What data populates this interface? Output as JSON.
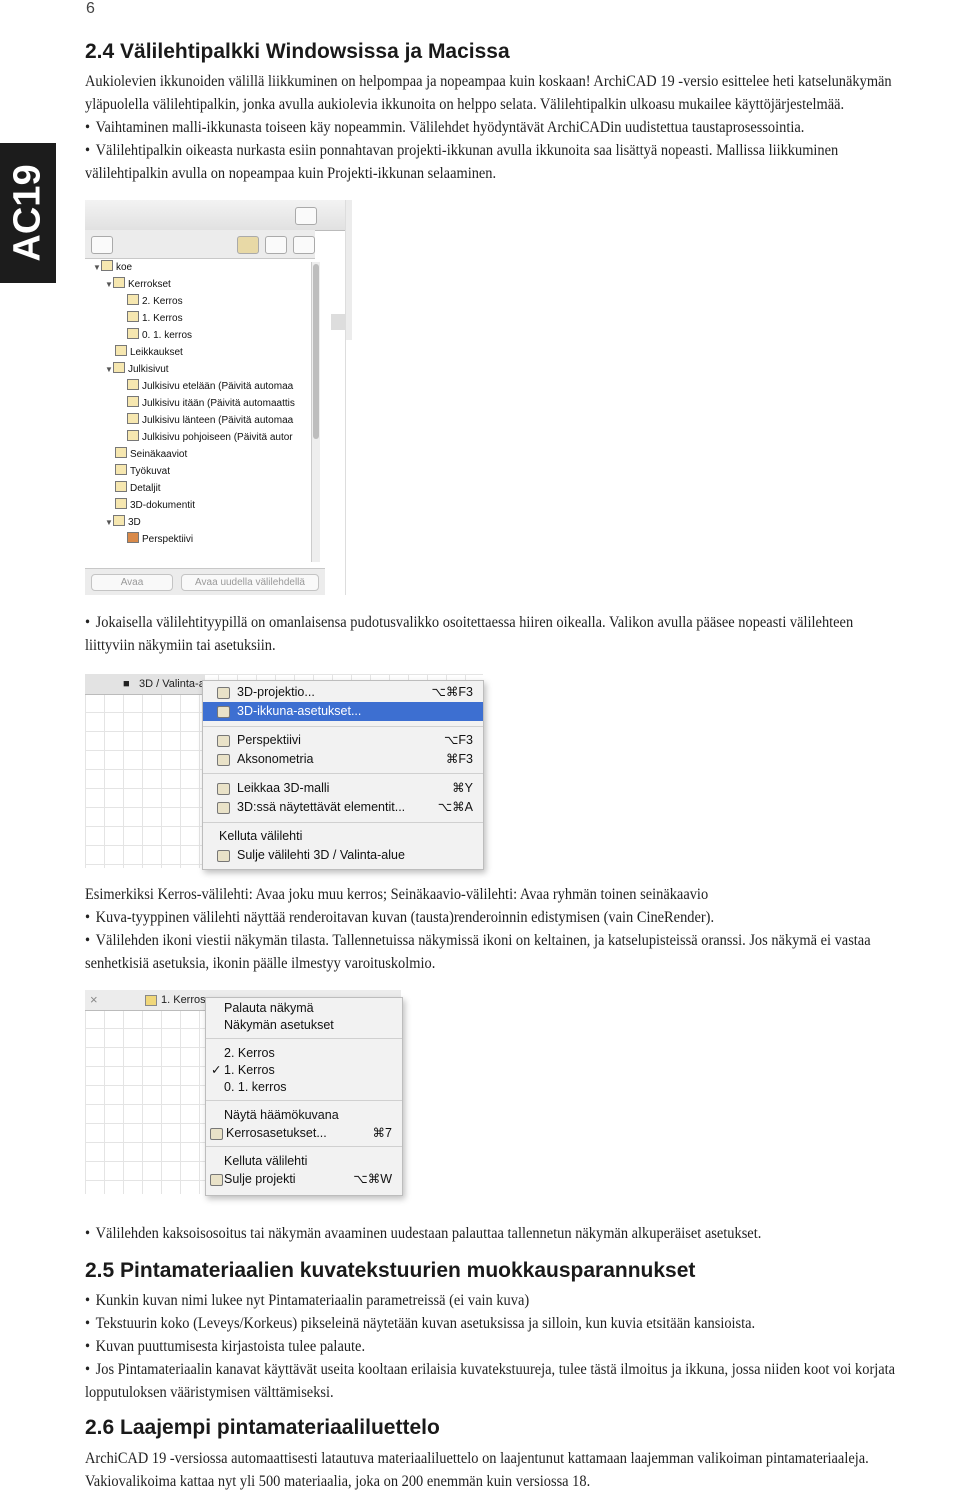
{
  "page_number": "6",
  "side_tab": "AC19",
  "section_24": {
    "title": "2.4 Välilehtipalkki Windowsissa ja Macissa",
    "intro": "Aukiolevien ikkunoiden välillä liikkuminen on helpompaa ja nopeampaa kuin koskaan! ArchiCAD 19 -versio esittelee heti katselunäkymän yläpuolella välilehtipalkin, jonka avulla aukiolevia ikkunoita on helppo selata. Välilehtipalkin ulkoasu mukailee käyttöjärjestelmää.",
    "bullet1": "Vaihtaminen malli-ikkunasta toiseen käy nopeammin. Välilehdet hyödyntävät ArchiCADin uudistettua taustaprosessointia.",
    "bullet2": "Välilehtipalkin oikeasta nurkasta esiin ponnahtavan projekti-ikkunan avulla ikkunoita saa lisättyä nopeasti. Mallissa liikkuminen välilehtipalkin avulla on nopeampaa kuin Projekti-ikkunan selaaminen.",
    "bullet3": "Jokaisella välilehtityypillä on omanlaisensa pudotusvalikko osoitettaessa hiiren oikealla. Valikon avulla pääsee nopeasti välilehteen liittyviin näkymiin tai asetuksiin.",
    "example": "Esimerkiksi Kerros-välilehti: Avaa joku muu kerros; Seinäkaavio-välilehti: Avaa ryhmän toinen seinäkaavio",
    "bullet4": "Kuva-tyyppinen välilehti näyttää renderoitavan kuvan (tausta)renderoinnin edistymisen (vain CineRender).",
    "bullet5": "Välilehden ikoni viestii näkymän tilasta. Tallennetuissa näkymissä ikoni on keltainen, ja katselupisteissä oranssi. Jos näkymä ei vastaa senhetkisiä asetuksia, ikonin päälle ilmestyy varoituskolmio.",
    "bullet6": "Välilehden kaksoisosoitus tai näkymän avaaminen uudestaan palauttaa tallennetun näkymän alkuperäiset asetukset."
  },
  "tree": {
    "items": [
      {
        "label": "koe",
        "arrow": "▼"
      },
      {
        "label": "Kerrokset",
        "arrow": "▼"
      },
      {
        "label": "2. Kerros",
        "arrow": ""
      },
      {
        "label": "1. Kerros",
        "arrow": ""
      },
      {
        "label": "0. 1. kerros",
        "arrow": ""
      },
      {
        "label": "Leikkaukset",
        "arrow": ""
      },
      {
        "label": "Julkisivut",
        "arrow": "▼"
      },
      {
        "label": "Julkisivu etelään (Päivitä automaa",
        "arrow": ""
      },
      {
        "label": "Julkisivu itään (Päivitä automaattis",
        "arrow": ""
      },
      {
        "label": "Julkisivu länteen (Päivitä automaa",
        "arrow": ""
      },
      {
        "label": "Julkisivu pohjoiseen (Päivitä autor",
        "arrow": ""
      },
      {
        "label": "Seinäkaaviot",
        "arrow": ""
      },
      {
        "label": "Työkuvat",
        "arrow": ""
      },
      {
        "label": "Detaljit",
        "arrow": ""
      },
      {
        "label": "3D-dokumentit",
        "arrow": ""
      },
      {
        "label": "3D",
        "arrow": "▼"
      },
      {
        "label": "Perspektiivi",
        "arrow": ""
      }
    ],
    "open_button": "Avaa",
    "open_new_tab_button": "Avaa uudella välilehdellä"
  },
  "menu_3d": {
    "tab_label": "3D / Valinta-a",
    "items": [
      {
        "label": "3D-projektio...",
        "shortcut": "⌥⌘F3"
      },
      {
        "label": "3D-ikkuna-asetukset...",
        "shortcut": ""
      },
      {
        "label": "Perspektiivi",
        "shortcut": "⌥F3"
      },
      {
        "label": "Aksonometria",
        "shortcut": "⌘F3"
      },
      {
        "label": "Leikkaa 3D-malli",
        "shortcut": "⌘Y"
      },
      {
        "label": "3D:ssä näytettävät elementit...",
        "shortcut": "⌥⌘A"
      },
      {
        "label": "Kelluta välilehti",
        "shortcut": ""
      },
      {
        "label": "Sulje välilehti 3D / Valinta-alue",
        "shortcut": ""
      }
    ]
  },
  "menu_floor": {
    "tab_label": "1. Kerros",
    "close_glyph": "×",
    "items": [
      {
        "label": "Palauta näkymä",
        "shortcut": ""
      },
      {
        "label": "Näkymän asetukset",
        "shortcut": ""
      },
      {
        "label": "2. Kerros",
        "shortcut": ""
      },
      {
        "label": "1. Kerros",
        "shortcut": "",
        "check": "✓"
      },
      {
        "label": "0. 1. kerros",
        "shortcut": ""
      },
      {
        "label": "Näytä häämökuvana",
        "shortcut": ""
      },
      {
        "label": "Kerrosasetukset...",
        "shortcut": "⌘7"
      },
      {
        "label": "Kelluta välilehti",
        "shortcut": ""
      },
      {
        "label": "Sulje projekti",
        "shortcut": "⌥⌘W"
      }
    ]
  },
  "section_25": {
    "title": "2.5 Pintamateriaalien kuvatekstuurien muokkausparannukset",
    "b1": "Kunkin kuvan nimi lukee nyt Pintamateriaalin parametreissä (ei vain kuva)",
    "b2": "Tekstuurin koko (Leveys/Korkeus) pikseleinä näytetään kuvan asetuksissa ja silloin, kun kuvia etsitään kansioista.",
    "b3": "Kuvan puuttumisesta kirjastoista tulee palaute.",
    "b4": "Jos Pintamateriaalin kanavat käyttävät useita kooltaan erilaisia kuvatekstuureja, tulee tästä ilmoitus ja ikkuna, jossa niiden koot voi korjata lopputuloksen vääristymisen välttämiseksi."
  },
  "section_26": {
    "title": "2.6 Laajempi pintamateriaaliluettelo",
    "body": "ArchiCAD 19 -versiossa automaattisesti latautuva materiaaliluettelo on laajentunut kattamaan laajemman valikoiman pintamateriaaleja. Vakiovalikoima kattaa nyt yli 500 materiaalia, joka on 200 enemmän kuin versiossa 18."
  },
  "colors": {
    "menu_highlight": "#3d6fd1",
    "side_tab": "#1c1c1c"
  }
}
